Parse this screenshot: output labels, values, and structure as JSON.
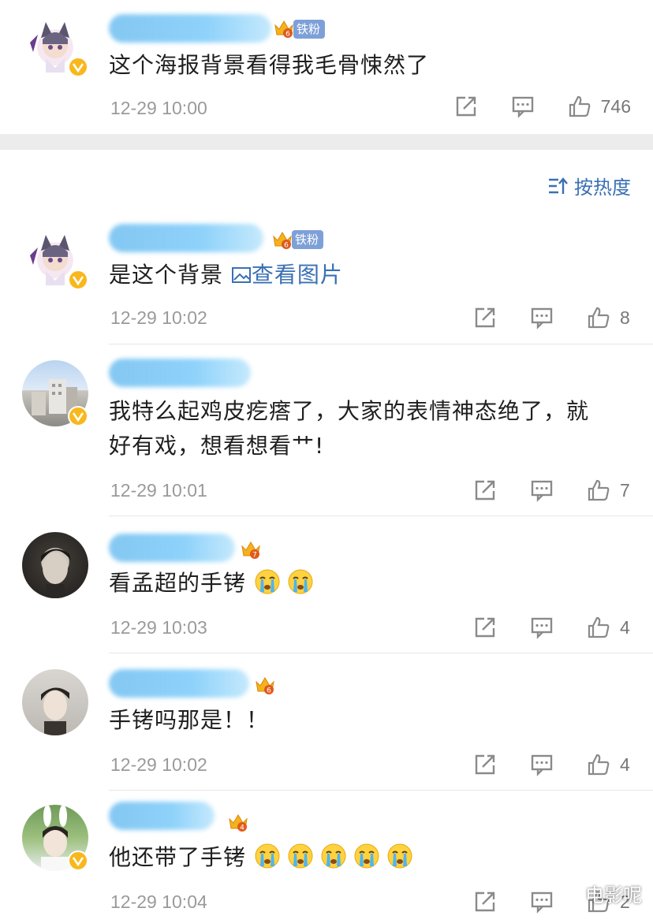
{
  "top_comment": {
    "badge": "铁粉",
    "text": "这个海报背景看得我毛骨悚然了",
    "time": "12-29 10:00",
    "likes": "746",
    "crown_level": "6"
  },
  "sort": {
    "label": "按热度"
  },
  "replies": [
    {
      "badge": "铁粉",
      "crown_level": "6",
      "text": "是这个背景",
      "link": "查看图片",
      "time": "12-29 10:02",
      "likes": "8"
    },
    {
      "text_line1": "我特么起鸡皮疙瘩了，大家的表情神态绝了，就",
      "text_line2": "好有戏，想看想看艹!",
      "time": "12-29 10:01",
      "likes": "7"
    },
    {
      "crown_level": "7",
      "text": "看孟超的手铐",
      "emoji_count": 2,
      "time": "12-29 10:03",
      "likes": "4"
    },
    {
      "crown_level": "6",
      "text": "手铐吗那是！！",
      "time": "12-29 10:02",
      "likes": "4"
    },
    {
      "crown_level": "4",
      "text": "他还带了手铐",
      "emoji_count": 5,
      "time": "12-29 10:04",
      "likes": "2"
    }
  ],
  "watermark": "电影呢",
  "colors": {
    "link": "#3a70b4",
    "verified": "#f8b81d",
    "fan_tag": "#7ea0d8",
    "time": "#9a9a9a"
  }
}
